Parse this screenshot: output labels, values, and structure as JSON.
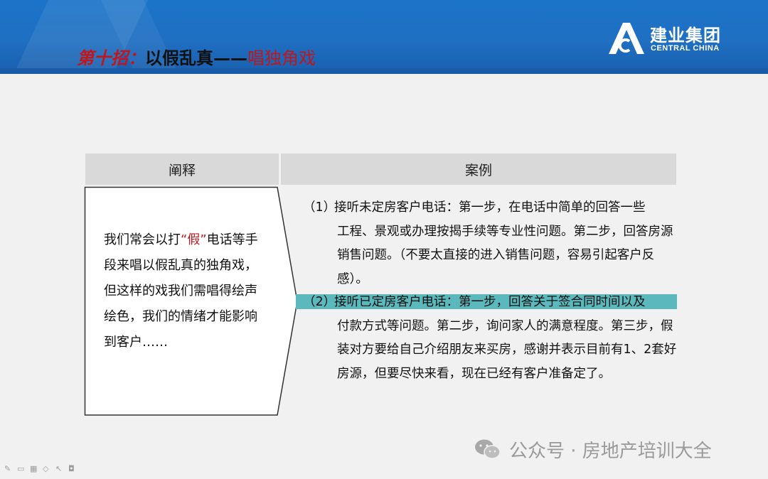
{
  "slide": {
    "title_part1": "第十招：",
    "title_part2": "以假乱真——",
    "title_part3": "唱独角戏"
  },
  "logo": {
    "name_cn": "建业集团",
    "name_en": "CENTRAL CHINA"
  },
  "table": {
    "left_header": "阐释",
    "right_header": "案例",
    "explanation": {
      "part1": "我们常会以打",
      "quoted": "“假”",
      "part2": "电话等手段来唱以假乱真的独角戏，但这样的戏我们需唱得绘声绘色，我们的情绪才能影响到客户……"
    },
    "cases": [
      {
        "number": "（1）",
        "first_line": "接听未定房客户电话：第一步，在电话中简单的回答一些",
        "rest": "工程、景观或办理按揭手续等专业性问题。第二步，回答房源销售问题。（不要太直接的进入销售问题，容易引起客户反感）。"
      },
      {
        "number": "（2）",
        "first_line": "接听已定房客户电话：第一步，回答关于签合同时间以及",
        "rest": "付款方式等问题。第二步，询问家人的满意程度。第三步，假装对方要给自己介绍朋友来买房，感谢并表示目前有1、2套好房源，但要尽快来看，现在已经有客户准备定了。"
      }
    ]
  },
  "watermark": {
    "text": "公众号 · 房地产培训大全"
  },
  "colors": {
    "header_blue": "#1f6fc2",
    "title_red": "#c0171c",
    "highlight_teal": "#5bb8bd",
    "header_gray": "#d9d9d9"
  },
  "icons": [
    "logo-mark-icon",
    "wechat-icon",
    "pen-icon",
    "slide-icon",
    "grid-icon",
    "eraser-icon",
    "pointer-icon",
    "camera-icon"
  ]
}
